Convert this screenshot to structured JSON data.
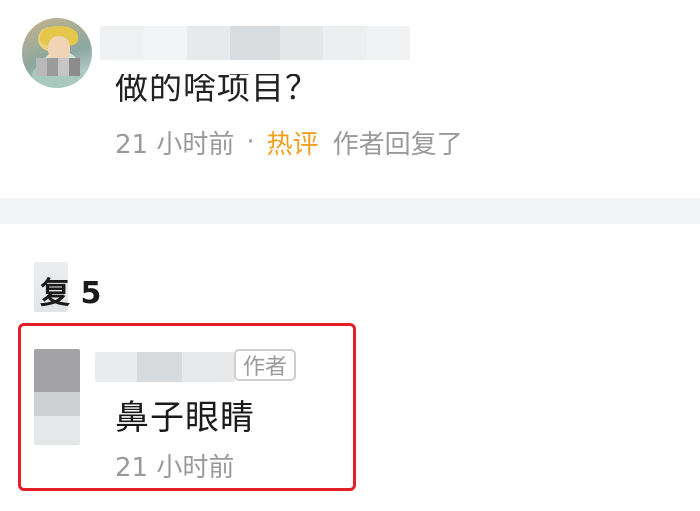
{
  "top_comment": {
    "text": "做的啥项目？",
    "time": "21 小时前",
    "separator": "·",
    "hot_label": "热评",
    "author_replied": "作者回复了",
    "hot_color": "#f0a020"
  },
  "replies": {
    "header": "复 5"
  },
  "reply": {
    "author_tag": "作者",
    "text": "鼻子眼睛",
    "time": "21 小时前",
    "highlight_color": "#e3202a"
  }
}
